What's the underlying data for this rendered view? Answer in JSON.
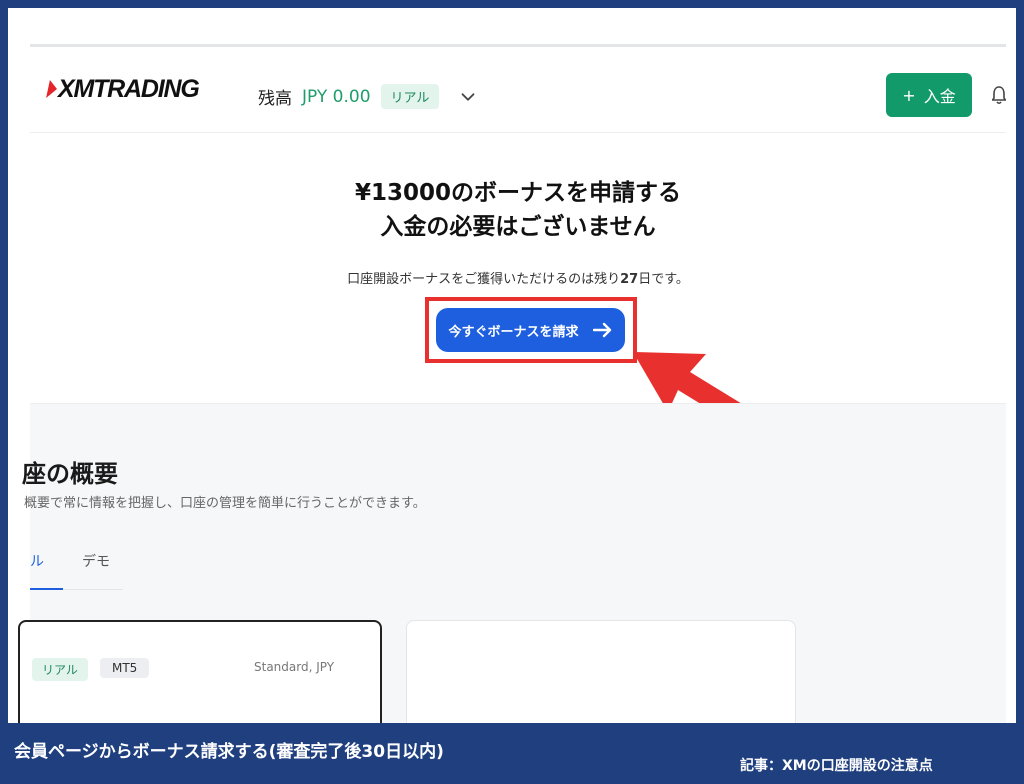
{
  "header": {
    "logo_text": "XMTRADING",
    "balance_label": "残高",
    "balance_value": "JPY 0.00",
    "account_type_badge": "リアル",
    "deposit_label": "入金",
    "deposit_plus": "+"
  },
  "promo": {
    "title_line1": "¥13000のボーナスを申請する",
    "title_line2": "入金の必要はございません",
    "notice_before": "口座開設ボーナスをご獲得いただけるのは残り",
    "notice_days": "27",
    "notice_after": "日です。",
    "claim_button_label": "今すぐボーナスを請求"
  },
  "summary": {
    "title": "座の概要",
    "description": "概要で常に情報を把握し、口座の管理を簡単に行うことができます。",
    "tabs": [
      {
        "label": "ル",
        "active": true
      },
      {
        "label": "デモ",
        "active": false
      }
    ],
    "account_card": {
      "badge_real": "リアル",
      "badge_platform": "MT5",
      "account_type": "Standard, JPY"
    }
  },
  "caption": {
    "main": "会員ページからボーナス請求する(審査完了後30日以内)",
    "side": "記事：XMの口座開設の注意点"
  },
  "colors": {
    "frame": "#1f3f7e",
    "accent_green": "#139a6b",
    "button_blue": "#1e5fe0",
    "highlight_red": "#e8302f"
  }
}
